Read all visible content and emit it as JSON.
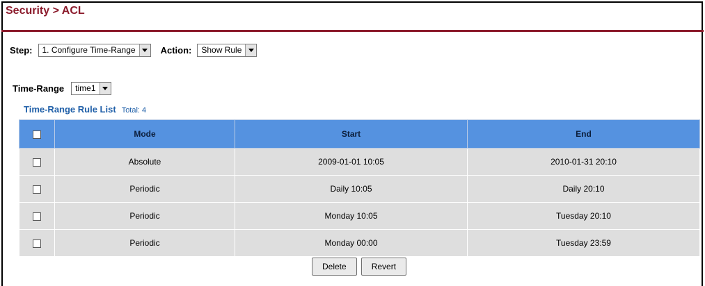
{
  "breadcrumb": "Security > ACL",
  "step": {
    "label": "Step:",
    "value": "1. Configure Time-Range"
  },
  "action": {
    "label": "Action:",
    "value": "Show Rule"
  },
  "time_range": {
    "label": "Time-Range",
    "value": "time1"
  },
  "list": {
    "title": "Time-Range Rule List",
    "total": "Total: 4"
  },
  "table": {
    "headers": [
      "Mode",
      "Start",
      "End"
    ],
    "rows": [
      {
        "mode": "Absolute",
        "start": "2009-01-01 10:05",
        "end": "2010-01-31 20:10"
      },
      {
        "mode": "Periodic",
        "start": "Daily 10:05",
        "end": "Daily 20:10"
      },
      {
        "mode": "Periodic",
        "start": "Monday 10:05",
        "end": "Tuesday 20:10"
      },
      {
        "mode": "Periodic",
        "start": "Monday 00:00",
        "end": "Tuesday 23:59"
      }
    ]
  },
  "buttons": {
    "delete": "Delete",
    "revert": "Revert"
  },
  "colors": {
    "title": "#8b1a2b",
    "header": "#5592e0",
    "list_title": "#1f5fa8",
    "row": "#dedede"
  }
}
